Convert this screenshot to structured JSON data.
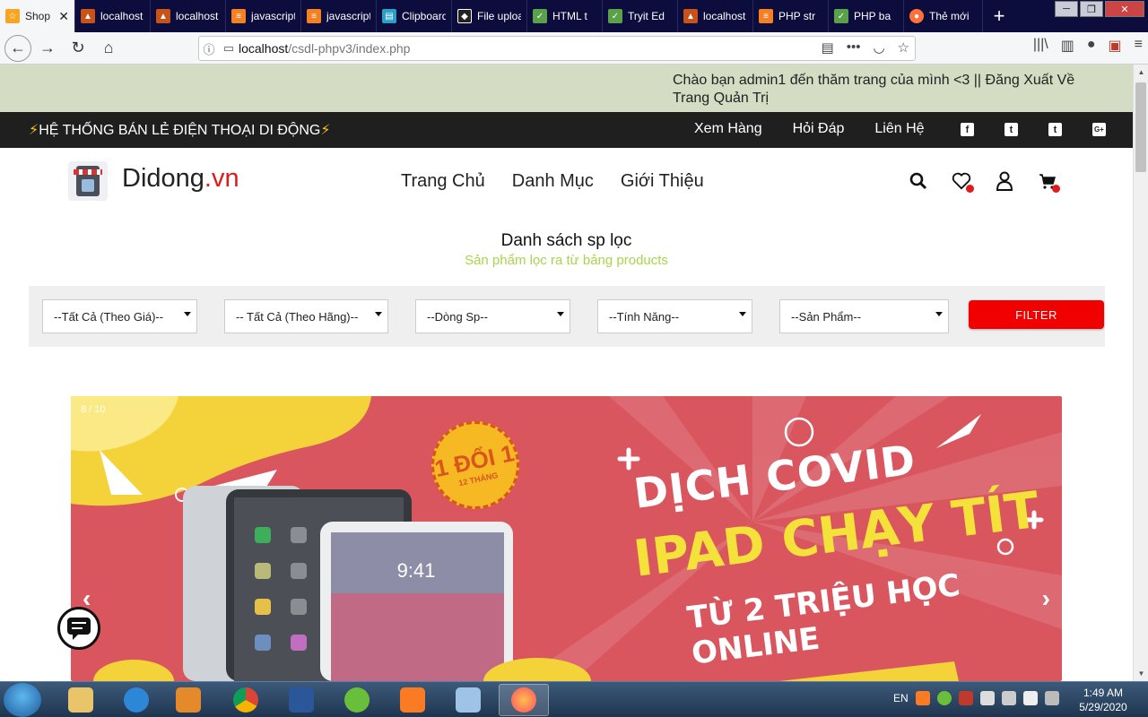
{
  "browser": {
    "tabs": [
      {
        "label": "Shop",
        "fav": "☆",
        "favbg": "#f5a623"
      },
      {
        "label": "localhost",
        "fav": "▲",
        "favbg": "#c7531b"
      },
      {
        "label": "localhost",
        "fav": "▲",
        "favbg": "#c7531b"
      },
      {
        "label": "javascript",
        "fav": "≡",
        "favbg": "#f48024"
      },
      {
        "label": "javascript",
        "fav": "≡",
        "favbg": "#f48024"
      },
      {
        "label": "Clipboard",
        "fav": "▤",
        "favbg": "#2aa0c8"
      },
      {
        "label": "File upload",
        "fav": "◆",
        "favbg": "#222"
      },
      {
        "label": "HTML t",
        "fav": "✓",
        "favbg": "#5aa14a"
      },
      {
        "label": "Tryit Ed",
        "fav": "✓",
        "favbg": "#5aa14a"
      },
      {
        "label": "localhost",
        "fav": "▲",
        "favbg": "#c7531b"
      },
      {
        "label": "PHP str",
        "fav": "≡",
        "favbg": "#f48024"
      },
      {
        "label": "PHP ba",
        "fav": "✓",
        "favbg": "#5aa14a"
      },
      {
        "label": "Thẻ mới",
        "fav": "●",
        "favbg": "#ff7139"
      }
    ],
    "url_host": "localhost",
    "url_path": "/csdl-phpv3/index.php"
  },
  "greeting": {
    "line": "Chào bạn admin1 đến thăm trang của mình <3 || Đăng Xuất Về Trang Quản Trị"
  },
  "topbar": {
    "slogan": "HỆ THỐNG BÁN LẺ ĐIỆN THOẠI DI ĐỘNG",
    "links": [
      "Xem Hàng",
      "Hỏi Đáp",
      "Liên Hệ"
    ],
    "social": [
      "f",
      "t",
      "t",
      "G+"
    ]
  },
  "header": {
    "brand_name": "Didong",
    "brand_tld": ".vn",
    "nav": [
      "Trang Chủ",
      "Danh Mục",
      "Giới Thiệu"
    ]
  },
  "section": {
    "title": "Danh sách sp lọc",
    "subtitle": "Sản phẩm lọc ra từ bảng products"
  },
  "filters": {
    "price": "--Tất Cả (Theo Giá)--",
    "brand": "-- Tất Cả (Theo Hãng)--",
    "line": "--Dòng Sp--",
    "feature": "--Tính Năng--",
    "product": "--Sản Phẩm--",
    "button": "FILTER"
  },
  "slider": {
    "counter": "8 / 10",
    "badge_top": "1 ĐỔI 1",
    "badge_bottom": "12 THÁNG",
    "line1": "DỊCH COVID",
    "line2": "IPAD CHẠY TÍT",
    "line3": "TỪ 2 TRIỆU HỌC ONLINE",
    "prev": "‹",
    "next": "›"
  },
  "taskbar": {
    "lang": "EN",
    "time": "1:49 AM",
    "date": "5/29/2020"
  },
  "colors": {
    "accent_red": "#e01b1b",
    "filter_button": "#f10000",
    "subtitle_green": "#a6d64a",
    "greeting_bg": "#d5dcc4",
    "topbar_bg": "#1f1f1f"
  }
}
